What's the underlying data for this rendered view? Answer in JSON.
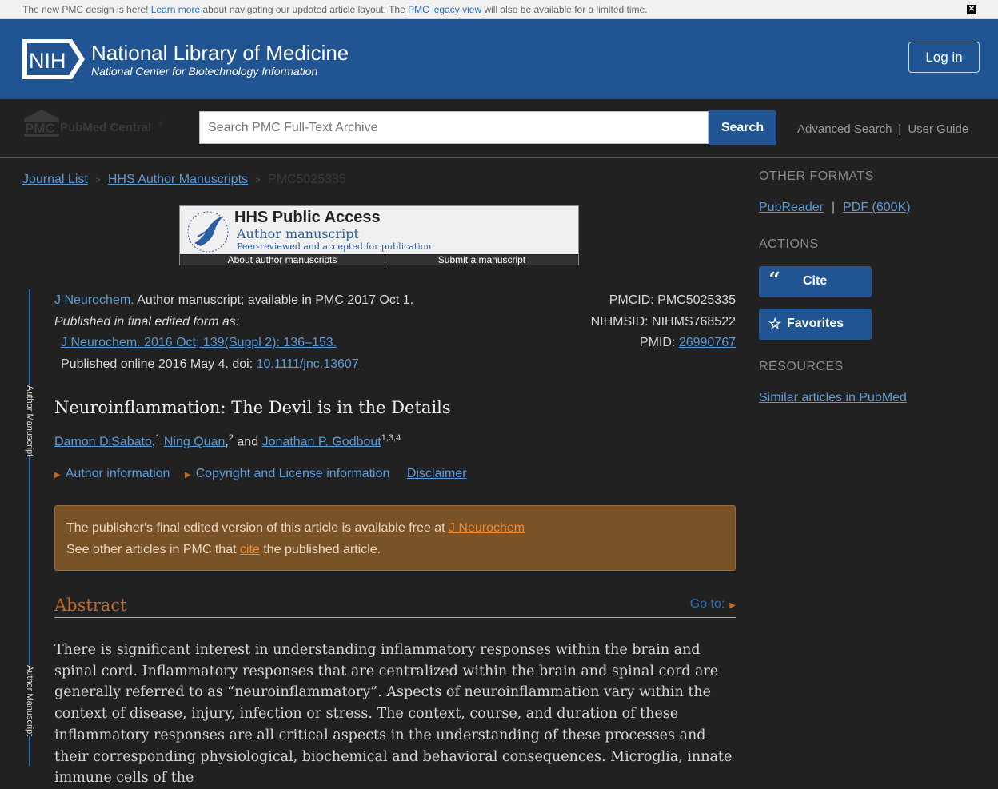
{
  "banner": {
    "prefix": "The new PMC design is here! ",
    "learn_more": "Learn more",
    "middle": " about navigating our updated article layout. The ",
    "legacy": "PMC legacy view",
    "suffix": " will also be available for a limited time.",
    "close": "✕"
  },
  "header": {
    "nih": "NIH",
    "title": "National Library of Medicine",
    "subtitle": "National Center for Biotechnology Information",
    "login": "Log in"
  },
  "search": {
    "logo_pmc": "PMC",
    "logo_text": "PubMed Central",
    "logo_reg": "®",
    "placeholder": "Search PMC Full-Text Archive",
    "button": "Search",
    "advanced": "Advanced Search",
    "separator": "|",
    "guide": "User Guide"
  },
  "breadcrumb": {
    "items": [
      "Journal List",
      "HHS Author Manuscripts"
    ],
    "current": "PMC5025335",
    "sep": ">"
  },
  "hhs": {
    "title": "HHS Public Access",
    "manuscript": "Author manuscript",
    "peer": "Peer-reviewed and accepted for publication",
    "about": "About author manuscripts",
    "submit": "Submit a manuscript"
  },
  "side_label": "Author Manuscript",
  "citation": {
    "journal": "J Neurochem.",
    "available": " Author manuscript; available in PMC 2017 Oct 1.",
    "published_as": "Published in final edited form as:",
    "ref": "J Neurochem. 2016 Oct; 139(Suppl 2): 136–153.",
    "online": "Published online 2016 May 4. doi: ",
    "doi": "10.1111/jnc.13607",
    "pmcid": "PMCID: PMC5025335",
    "nihmsid": "NIHMSID: NIHMS768522",
    "pmid_label": "PMID: ",
    "pmid": "26990767"
  },
  "article": {
    "title": "Neuroinflammation: The Devil is in the Details",
    "authors": [
      {
        "name": "Damon DiSabato",
        "sup": "1",
        "after": ", "
      },
      {
        "name": "Ning Quan",
        "sup": "2",
        "after": " and "
      },
      {
        "name": "Jonathan P. Godbout",
        "sup": "1,3,4",
        "after": ""
      }
    ],
    "author_info": "Author information",
    "copyright": "Copyright and License information",
    "disclaimer": "Disclaimer"
  },
  "notice": {
    "l1_text": "The publisher's final edited version of this article is available free at ",
    "l1_link": "J Neurochem",
    "l2_text_a": "See other articles in PMC that ",
    "l2_link": "cite",
    "l2_text_b": " the published article."
  },
  "abstract": {
    "heading": "Abstract",
    "goto": "Go to:",
    "text": "There is significant interest in understanding inflammatory responses within the brain and spinal cord. Inflammatory responses that are centralized within the brain and spinal cord are generally referred to as “neuroinflammatory”. Aspects of neuroinflammation vary within the context of disease, injury, infection or stress. The context, course, and duration of these inflammatory responses are all critical aspects in the understanding of these processes and their corresponding physiological, biochemical and behavioral consequences. Microglia, innate immune cells of the"
  },
  "sidebar": {
    "other_formats": "OTHER FORMATS",
    "pubreader": "PubReader",
    "pipe": "|",
    "pdf": "PDF (600K)",
    "actions": "ACTIONS",
    "cite": "Cite",
    "cite_icon": "“",
    "favorites": "Favorites",
    "fav_icon": "☆",
    "resources": "RESOURCES",
    "similar": "Similar articles in PubMed"
  },
  "colors": {
    "nlm_blue": "#205493",
    "accent_orange": "#c46a20",
    "notice_bg": "#7a5228",
    "link": "#5a9ad6"
  }
}
